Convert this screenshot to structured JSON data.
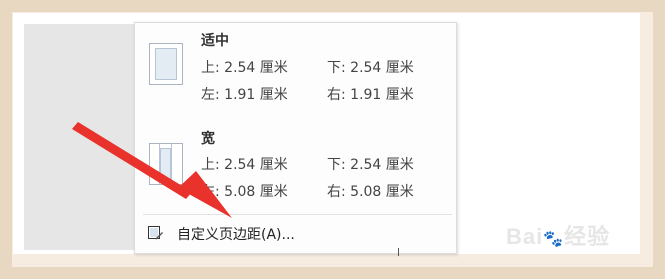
{
  "menu": {
    "presets": [
      {
        "title": "适中",
        "top": "上: 2.54 厘米",
        "bottom": "下: 2.54 厘米",
        "left": "左: 1.91 厘米",
        "right": "右: 1.91 厘米"
      },
      {
        "title": "宽",
        "top": "上: 2.54 厘米",
        "bottom": "下: 2.54 厘米",
        "left": "左: 5.08 厘米",
        "right": "右: 5.08 厘米"
      }
    ],
    "custom_label": "自定义页边距(A)..."
  },
  "annotation": {
    "arrow_color": "#e8322b"
  },
  "watermark": "Bai 经验"
}
